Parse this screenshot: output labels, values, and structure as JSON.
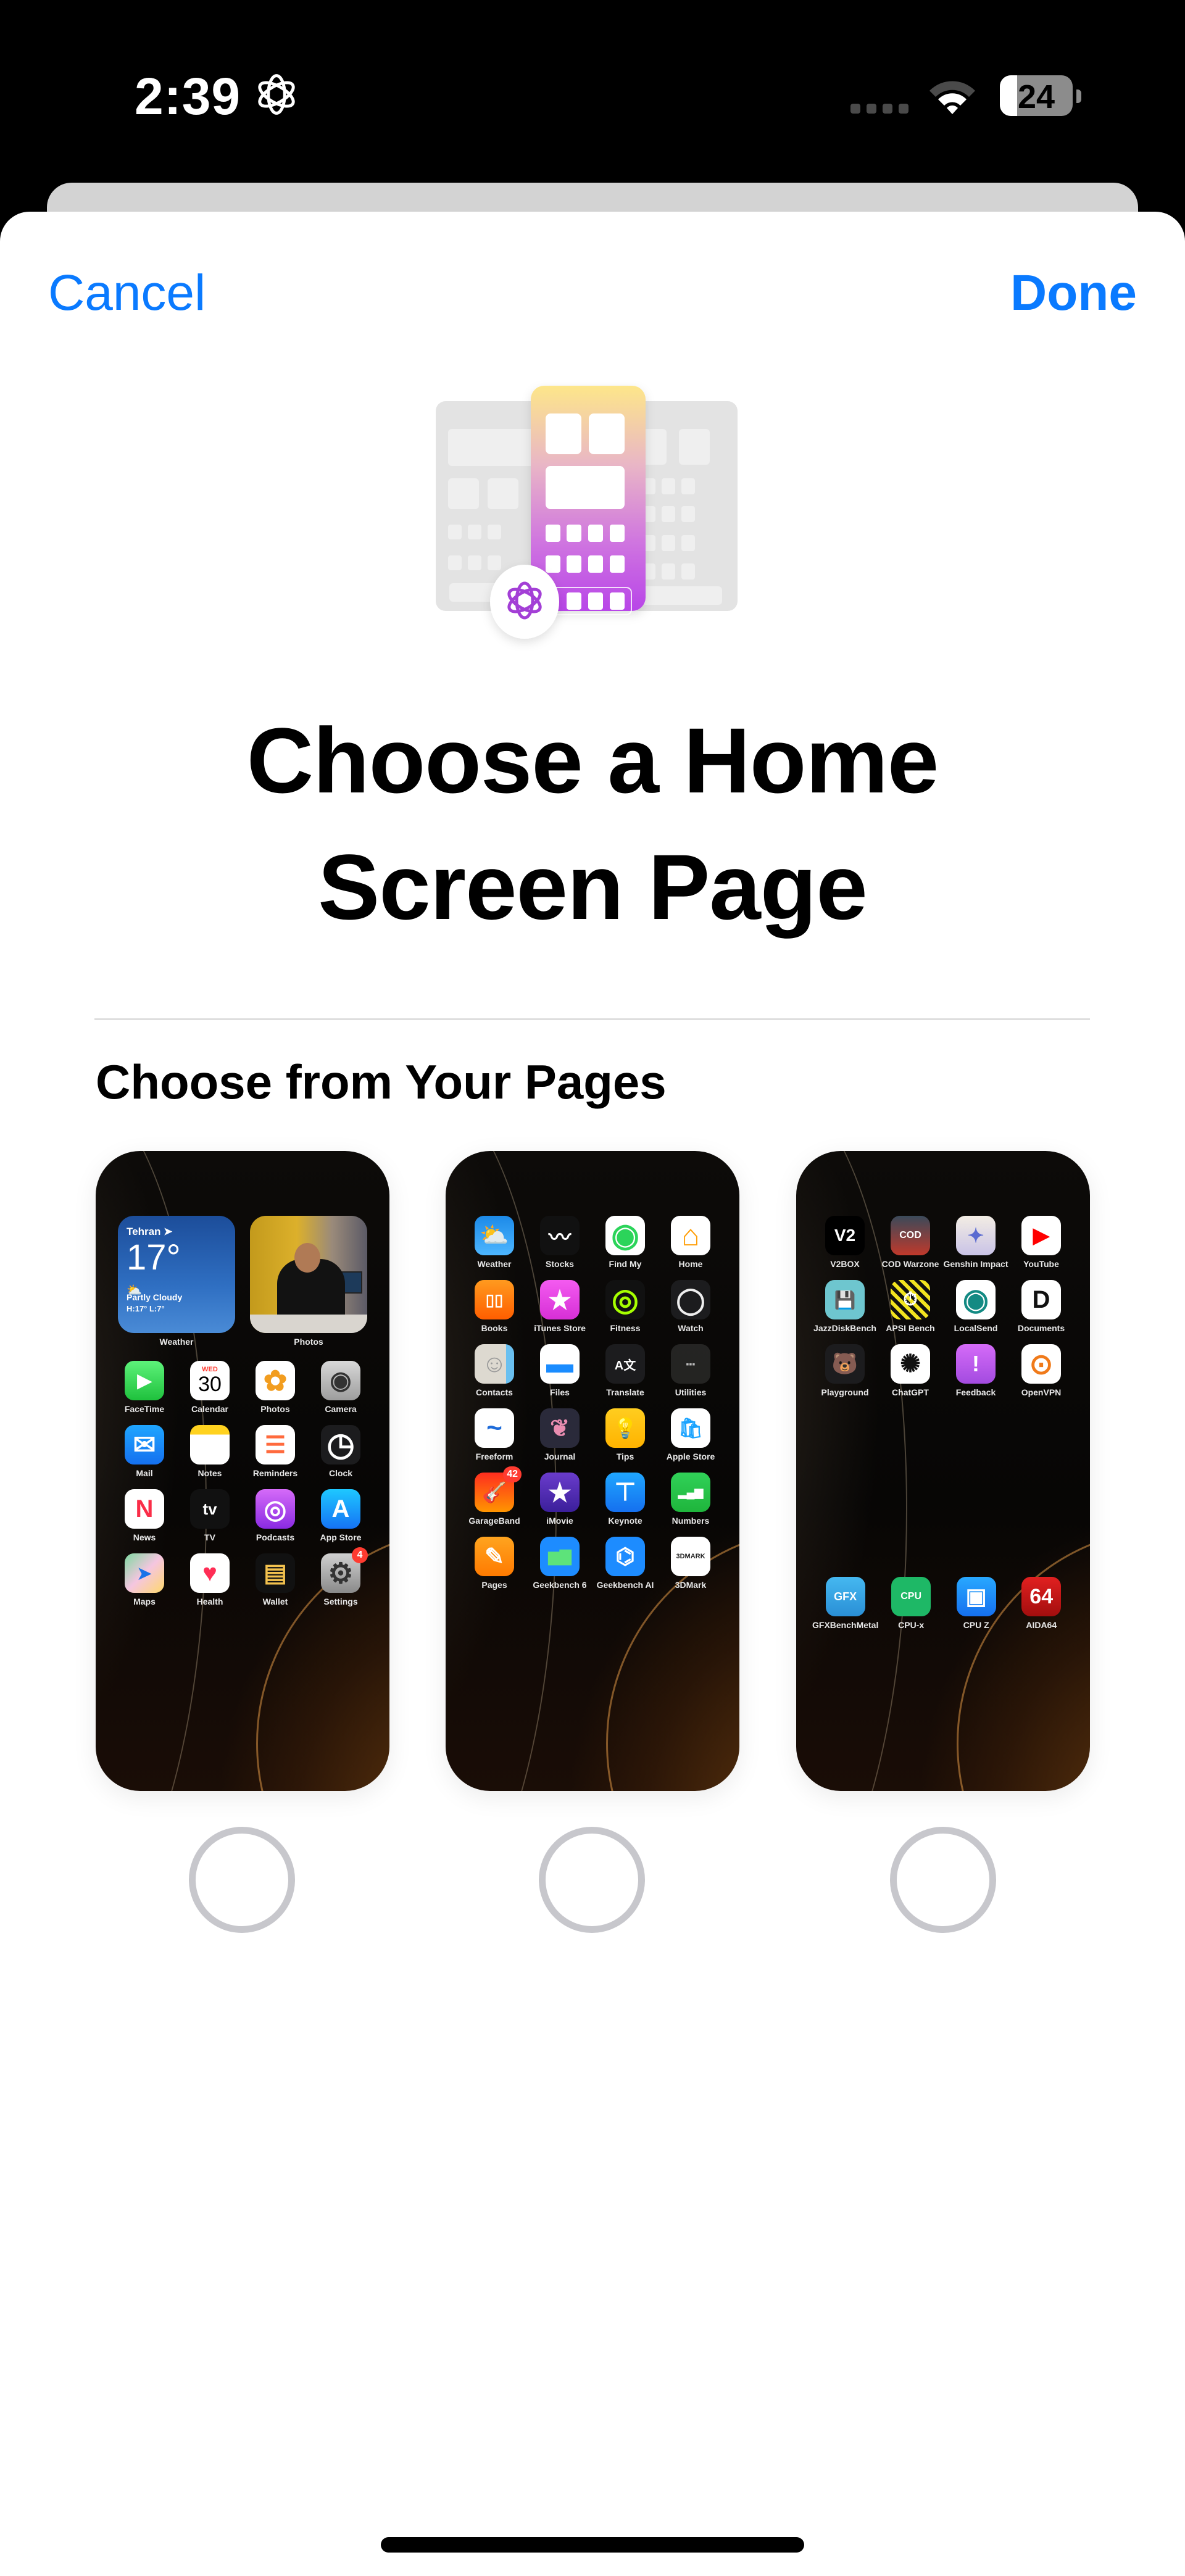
{
  "status_bar": {
    "time": "2:39",
    "focus_icon": "focus-mode-icon",
    "signal_icon": "cellular-no-signal-icon",
    "wifi_icon": "wifi-icon",
    "battery_level": "24",
    "battery_fraction": 0.24
  },
  "nav": {
    "cancel_label": "Cancel",
    "done_label": "Done",
    "accent_color": "#0A7AFF"
  },
  "header": {
    "illustration": "home-screen-pages-icon",
    "title_line1": "Choose a Home",
    "title_line2": "Screen Page"
  },
  "section": {
    "title": "Choose from Your Pages"
  },
  "pages": [
    {
      "selected": false,
      "widgets": {
        "weather": {
          "city": "Tehran",
          "temperature": "17°",
          "condition": "Partly Cloudy",
          "high_low": "H:17° L:7°",
          "label": "Weather"
        },
        "photos": {
          "label": "Photos"
        }
      },
      "apps": [
        {
          "name": "FaceTime",
          "icon": "facetime-icon"
        },
        {
          "name": "Calendar",
          "icon": "calendar-icon",
          "day": "WED",
          "date": "30"
        },
        {
          "name": "Photos",
          "icon": "photos-icon"
        },
        {
          "name": "Camera",
          "icon": "camera-icon"
        },
        {
          "name": "Mail",
          "icon": "mail-icon"
        },
        {
          "name": "Notes",
          "icon": "notes-icon"
        },
        {
          "name": "Reminders",
          "icon": "reminders-icon"
        },
        {
          "name": "Clock",
          "icon": "clock-icon"
        },
        {
          "name": "News",
          "icon": "news-icon"
        },
        {
          "name": "TV",
          "icon": "tv-icon"
        },
        {
          "name": "Podcasts",
          "icon": "podcasts-icon"
        },
        {
          "name": "App Store",
          "icon": "app-store-icon"
        },
        {
          "name": "Maps",
          "icon": "maps-icon"
        },
        {
          "name": "Health",
          "icon": "health-icon"
        },
        {
          "name": "Wallet",
          "icon": "wallet-icon"
        },
        {
          "name": "Settings",
          "icon": "settings-icon",
          "badge": "4"
        }
      ]
    },
    {
      "selected": false,
      "apps": [
        {
          "name": "Weather",
          "icon": "weather-icon"
        },
        {
          "name": "Stocks",
          "icon": "stocks-icon"
        },
        {
          "name": "Find My",
          "icon": "find-my-icon"
        },
        {
          "name": "Home",
          "icon": "home-icon"
        },
        {
          "name": "Books",
          "icon": "books-icon"
        },
        {
          "name": "iTunes Store",
          "icon": "itunes-store-icon"
        },
        {
          "name": "Fitness",
          "icon": "fitness-icon"
        },
        {
          "name": "Watch",
          "icon": "watch-icon"
        },
        {
          "name": "Contacts",
          "icon": "contacts-icon"
        },
        {
          "name": "Files",
          "icon": "files-icon"
        },
        {
          "name": "Translate",
          "icon": "translate-icon"
        },
        {
          "name": "Utilities",
          "icon": "folder-icon"
        },
        {
          "name": "Freeform",
          "icon": "freeform-icon"
        },
        {
          "name": "Journal",
          "icon": "journal-icon"
        },
        {
          "name": "Tips",
          "icon": "tips-icon"
        },
        {
          "name": "Apple Store",
          "icon": "apple-store-icon"
        },
        {
          "name": "GarageBand",
          "icon": "garageband-icon",
          "badge": "42"
        },
        {
          "name": "iMovie",
          "icon": "imovie-icon"
        },
        {
          "name": "Keynote",
          "icon": "keynote-icon"
        },
        {
          "name": "Numbers",
          "icon": "numbers-icon"
        },
        {
          "name": "Pages",
          "icon": "pages-icon"
        },
        {
          "name": "Geekbench 6",
          "icon": "geekbench-icon"
        },
        {
          "name": "Geekbench AI",
          "icon": "geekbench-ai-icon"
        },
        {
          "name": "3DMark",
          "icon": "3dmark-icon"
        }
      ]
    },
    {
      "selected": false,
      "apps": [
        {
          "name": "V2BOX",
          "icon": "v2box-icon"
        },
        {
          "name": "COD Warzone",
          "icon": "cod-warzone-icon"
        },
        {
          "name": "Genshin Impact",
          "icon": "genshin-impact-icon"
        },
        {
          "name": "YouTube",
          "icon": "youtube-icon"
        },
        {
          "name": "JazzDiskBench",
          "icon": "jazzdiskbench-icon"
        },
        {
          "name": "APSI Bench",
          "icon": "apsi-bench-icon"
        },
        {
          "name": "LocalSend",
          "icon": "localsend-icon"
        },
        {
          "name": "Documents",
          "icon": "documents-icon"
        },
        {
          "name": "Playground",
          "icon": "playground-icon"
        },
        {
          "name": "ChatGPT",
          "icon": "chatgpt-icon"
        },
        {
          "name": "Feedback",
          "icon": "feedback-icon"
        },
        {
          "name": "OpenVPN",
          "icon": "openvpn-icon"
        }
      ],
      "bottom_apps": [
        {
          "name": "GFXBenchMetal",
          "icon": "gfxbench-icon",
          "text": "GFX"
        },
        {
          "name": "CPU-x",
          "icon": "cpu-x-icon",
          "text": "CPU"
        },
        {
          "name": "CPU Z",
          "icon": "cpu-z-icon"
        },
        {
          "name": "AIDA64",
          "icon": "aida64-icon",
          "text": "64"
        }
      ]
    }
  ]
}
